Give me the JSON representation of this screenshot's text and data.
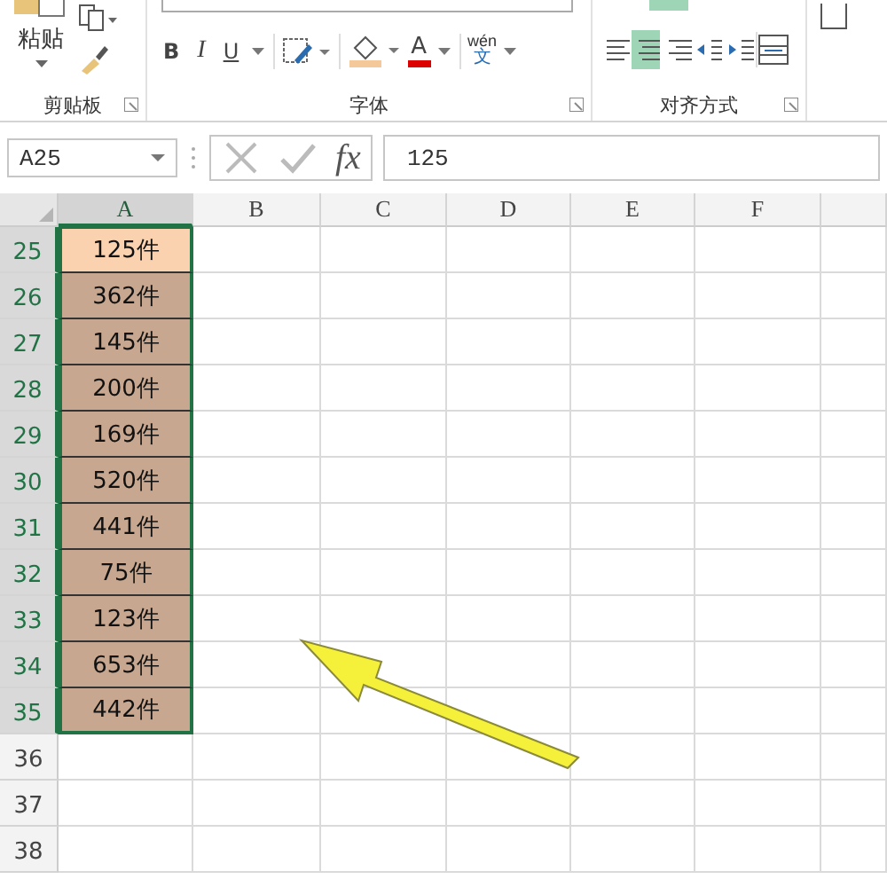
{
  "ribbon": {
    "clipboard": {
      "paste_label": "粘贴",
      "group_label": "剪贴板"
    },
    "font": {
      "tools": [
        {
          "kind": "bold",
          "text": "B"
        },
        {
          "kind": "italic",
          "text": "I"
        },
        {
          "kind": "underline",
          "text": "U"
        }
      ],
      "font_color": "A",
      "phonetic_top": "wén",
      "phonetic_bottom": "文",
      "group_label": "字体"
    },
    "alignment": {
      "buttons": [
        {
          "kind": "left",
          "selected": false
        },
        {
          "kind": "center",
          "selected": true
        },
        {
          "kind": "right",
          "selected": false
        },
        {
          "kind": "outdent",
          "selected": false
        },
        {
          "kind": "indent",
          "selected": false
        }
      ],
      "group_label": "对齐方式"
    }
  },
  "name_box": "A25",
  "fx": "fx",
  "formula_value": "125",
  "columns": [
    {
      "label": "A",
      "selected": true
    },
    {
      "label": "B",
      "selected": false
    },
    {
      "label": "C",
      "selected": false
    },
    {
      "label": "D",
      "selected": false
    },
    {
      "label": "E",
      "selected": false
    },
    {
      "label": "F",
      "selected": false
    }
  ],
  "rows": [
    {
      "number": "25",
      "selected": true,
      "cell_a": "125件",
      "active": true
    },
    {
      "number": "26",
      "selected": true,
      "cell_a": "362件",
      "active": false
    },
    {
      "number": "27",
      "selected": true,
      "cell_a": "145件",
      "active": false
    },
    {
      "number": "28",
      "selected": true,
      "cell_a": "200件",
      "active": false
    },
    {
      "number": "29",
      "selected": true,
      "cell_a": "169件",
      "active": false
    },
    {
      "number": "30",
      "selected": true,
      "cell_a": "520件",
      "active": false
    },
    {
      "number": "31",
      "selected": true,
      "cell_a": "441件",
      "active": false
    },
    {
      "number": "32",
      "selected": true,
      "cell_a": "75件",
      "active": false
    },
    {
      "number": "33",
      "selected": true,
      "cell_a": "123件",
      "active": false
    },
    {
      "number": "34",
      "selected": true,
      "cell_a": "653件",
      "active": false
    },
    {
      "number": "35",
      "selected": true,
      "cell_a": "442件",
      "active": false
    },
    {
      "number": "36",
      "selected": false
    },
    {
      "number": "37",
      "selected": false
    },
    {
      "number": "38",
      "selected": false
    }
  ]
}
